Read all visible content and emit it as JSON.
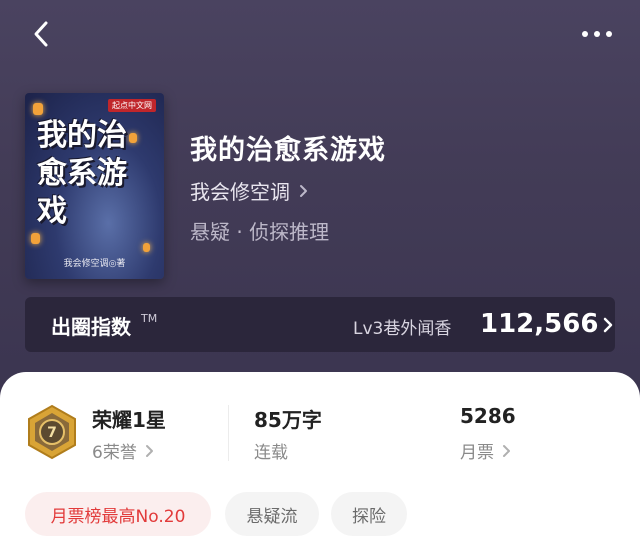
{
  "book": {
    "title": "我的治愈系游戏",
    "author": "我会修空调",
    "genre": "悬疑 · 侦探推理",
    "cover": {
      "publisher_logo": "起点中文网",
      "title_art": "我的治愈系游戏",
      "author_credit": "我会修空调◎著"
    }
  },
  "index": {
    "label": "出圈指数",
    "trademark": "TM",
    "level": "Lv3巷外闻香",
    "value": "112,566"
  },
  "stats": {
    "honor": {
      "title": "荣耀1星",
      "sub": "6荣誉",
      "badge_number": "7"
    },
    "words": {
      "title": "85万字",
      "sub": "连载"
    },
    "tickets": {
      "title": "5286",
      "sub": "月票"
    }
  },
  "tags": [
    "月票榜最高No.20",
    "悬疑流",
    "探险"
  ],
  "icons": {
    "back": "chevron-left-icon",
    "more": "more-dots-icon",
    "chevron": "chevron-right-icon",
    "badge": "honor-badge-icon"
  },
  "colors": {
    "hero_bg": "#433c57",
    "accent_red": "#e23a3a",
    "badge_gold": "#d9a436"
  }
}
